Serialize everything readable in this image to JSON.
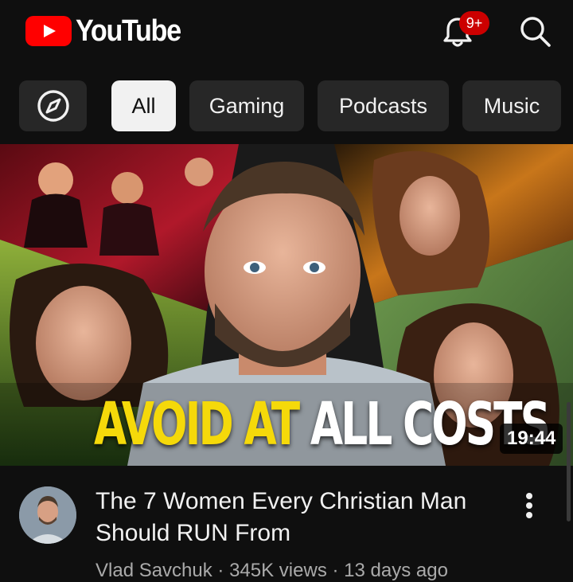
{
  "app": {
    "brand": "YouTube",
    "notification_badge": "9+"
  },
  "icons": {
    "brand": "youtube-play-icon",
    "notifications": "bell-icon",
    "search": "search-icon",
    "explore": "compass-icon",
    "more": "more-vertical-icon"
  },
  "chips": {
    "all": "All",
    "gaming": "Gaming",
    "podcasts": "Podcasts",
    "music": "Music"
  },
  "video": {
    "thumbnail_text_highlight": "AVOID AT",
    "thumbnail_text_main": "ALL COSTS",
    "duration": "19:44",
    "title": "The 7 Women Every Christian Man Should RUN From",
    "meta": "Vlad Savchuk · 345K views · 13 days ago"
  },
  "colors": {
    "background": "#0f0f0f",
    "brand_red": "#ff0000",
    "badge": "#cc0000",
    "chip": "#272727",
    "chip_active": "#f1f1f1",
    "thumbnail_accent": "#f5d90a"
  }
}
